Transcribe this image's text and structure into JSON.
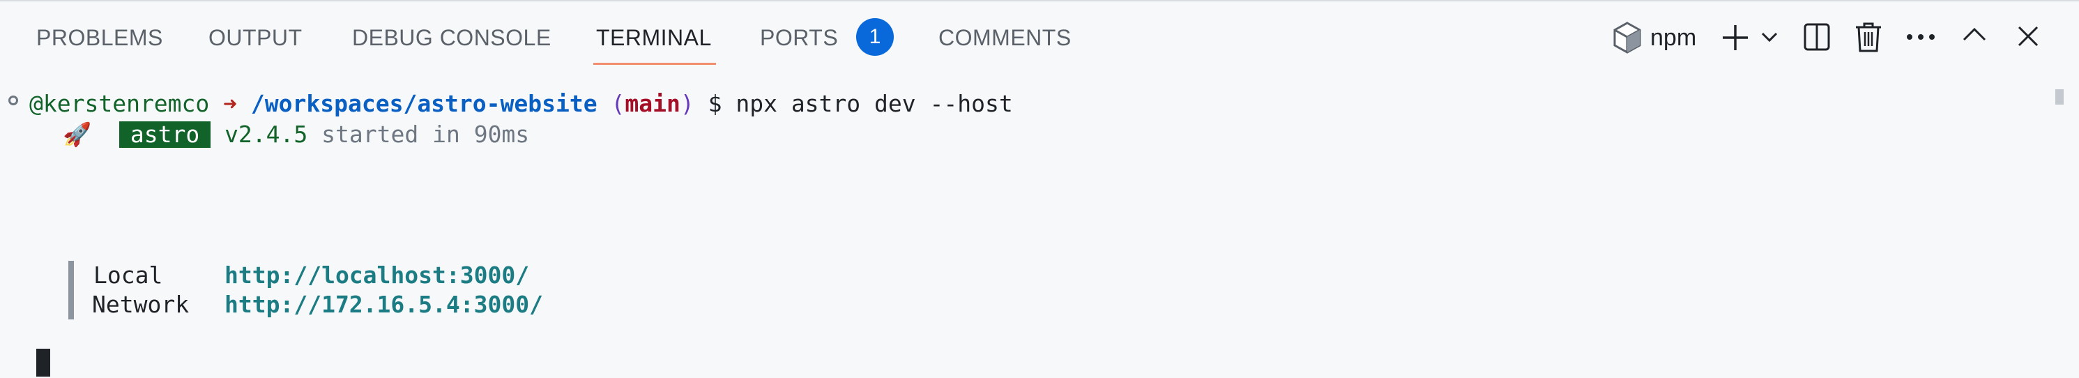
{
  "tabs": [
    {
      "label": "PROBLEMS"
    },
    {
      "label": "OUTPUT"
    },
    {
      "label": "DEBUG CONSOLE"
    },
    {
      "label": "TERMINAL",
      "active": true
    },
    {
      "label": "PORTS",
      "badge": "1"
    },
    {
      "label": "COMMENTS"
    }
  ],
  "actions": {
    "profile_label": "npm",
    "profile_icon": "npm-package-icon",
    "new_terminal_icon": "plus-icon",
    "dropdown_icon": "chevron-down-icon",
    "split_icon": "split-terminal-icon",
    "kill_icon": "trash-icon",
    "more_icon": "ellipsis-icon",
    "maximize_icon": "chevron-up-icon",
    "close_icon": "close-icon"
  },
  "terminal": {
    "prompt": {
      "user": "@kerstenremco",
      "arrow": "➜",
      "path": "/workspaces/astro-website",
      "paren_open": "(",
      "branch": "main",
      "paren_close": ")",
      "symbol": "$",
      "command": "npx astro dev --host"
    },
    "startup": {
      "rocket": "🚀",
      "app": "astro",
      "version": "v2.4.5",
      "message": "started in 90ms"
    },
    "servers": [
      {
        "label": "Local",
        "url": "http://localhost:3000/"
      },
      {
        "label": "Network",
        "url": "http://172.16.5.4:3000/"
      }
    ]
  },
  "colors": {
    "background": "#f6f8fa",
    "accent_underline": "#f38d70",
    "badge": "#0969da",
    "user": "#116329",
    "path": "#0a5fc2",
    "branch": "#a40e26",
    "url": "#1b7c83"
  }
}
